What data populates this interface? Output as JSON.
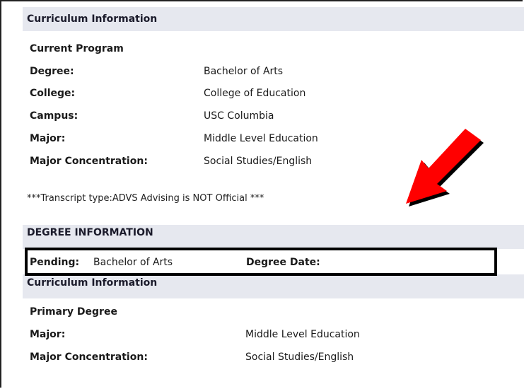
{
  "curriculum1": {
    "header": "Curriculum Information",
    "subheading": "Current Program",
    "rows": [
      {
        "label": "Degree:",
        "value": "Bachelor of Arts"
      },
      {
        "label": "College:",
        "value": "College of Education"
      },
      {
        "label": "Campus:",
        "value": "USC Columbia"
      },
      {
        "label": "Major:",
        "value": "Middle Level Education"
      },
      {
        "label": "Major Concentration:",
        "value": "Social Studies/English"
      }
    ]
  },
  "transcript_note": "***Transcript type:ADVS Advising is NOT Official ***",
  "degree_info": {
    "header": "DEGREE INFORMATION",
    "pending_label": "Pending:",
    "pending_value": "Bachelor of Arts",
    "degree_date_label": "Degree Date:"
  },
  "curriculum2": {
    "header": "Curriculum Information",
    "subheading": "Primary Degree",
    "rows": [
      {
        "label": "Major:",
        "value": "Middle Level Education"
      },
      {
        "label": "Major Concentration:",
        "value": "Social Studies/English"
      }
    ]
  },
  "colors": {
    "band_background": "#e6e8ef",
    "arrow_fill": "#ff0000",
    "arrow_shadow": "#000000",
    "highlight_border": "#000000"
  }
}
